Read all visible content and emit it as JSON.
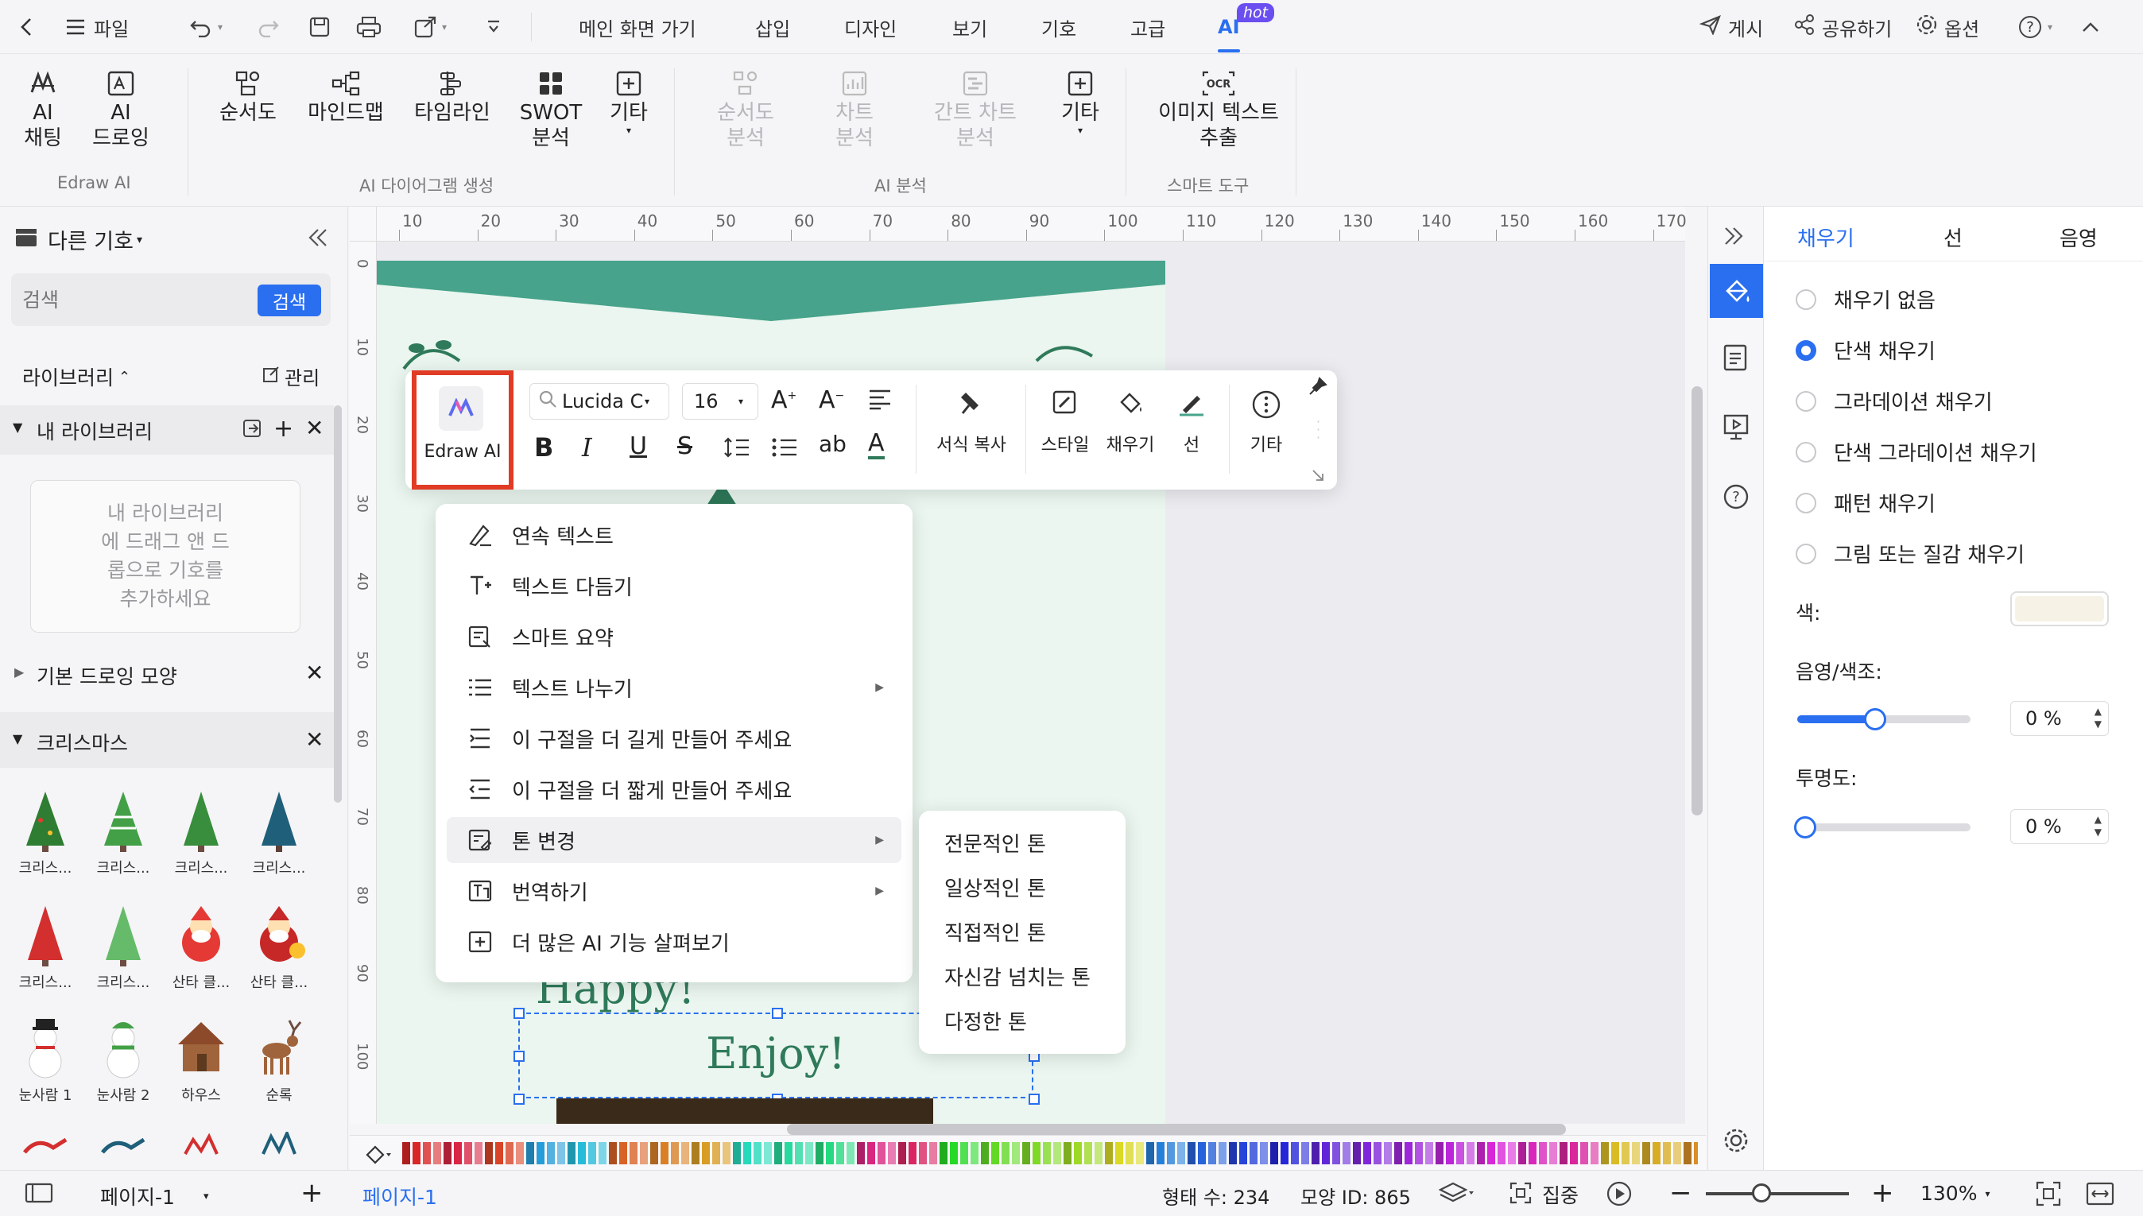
{
  "topbar": {
    "file": "파일",
    "tabs": [
      "메인 화면 가기",
      "삽입",
      "디자인",
      "보기",
      "기호",
      "고급",
      "AI"
    ],
    "ai_badge": "hot",
    "publish": "게시",
    "share": "공유하기",
    "options": "옵션",
    "help": "?"
  },
  "ribbon": {
    "ai_chat": "AI\n채팅",
    "ai_draw": "AI\n드로잉",
    "group1": "Edraw AI",
    "flowchart": "순서도",
    "mindmap": "마인드맵",
    "timeline": "타임라인",
    "swot": "SWOT\n분석",
    "other1": "기타",
    "group2": "AI 다이어그램 생성",
    "flow_analysis": "순서도\n분석",
    "chart_analysis": "차트\n분석",
    "gantt_analysis": "간트 차트\n분석",
    "other2": "기타",
    "group3": "AI 분석",
    "ocr": "이미지 텍스트\n추출",
    "group4": "스마트 도구"
  },
  "left": {
    "title": "다른 기호",
    "search_placeholder": "검색",
    "search_btn": "검색",
    "library": "라이브러리",
    "manage": "관리",
    "my_library": "내 라이브러리",
    "drop_hint": "내 라이브러리\n에 드래그 앤 드\n롭으로 기호를\n추가하세요",
    "basic_shapes": "기본 드로잉 모양",
    "christmas": "크리스마스",
    "symbols": [
      "크리스...",
      "크리스...",
      "크리스...",
      "크리스...",
      "크리스...",
      "크리스...",
      "산타 클...",
      "산타 클...",
      "눈사람 1",
      "눈사람 2",
      "하우스",
      "순록"
    ]
  },
  "ruler": {
    "top": [
      "10",
      "20",
      "30",
      "40",
      "50",
      "60",
      "70",
      "80",
      "90",
      "100",
      "110",
      "120",
      "130",
      "140",
      "150",
      "160",
      "170"
    ],
    "left": [
      "0",
      "10",
      "20",
      "30",
      "40",
      "50",
      "60",
      "70",
      "80",
      "90",
      "100"
    ]
  },
  "toolbar": {
    "edraw_ai": "Edraw AI",
    "font": "Lucida C",
    "size": "16",
    "ab": "ab",
    "format_copy": "서식 복사",
    "style": "스타일",
    "fill": "채우기",
    "line": "선",
    "more": "기타"
  },
  "context_menu": {
    "items": [
      "연속 텍스트",
      "텍스트 다듬기",
      "스마트 요약",
      "텍스트 나누기",
      "이 구절을 더 길게 만들어 주세요",
      "이 구절을 더 짧게 만들어 주세요",
      "톤 변경",
      "번역하기",
      "더 많은 AI 기능 살펴보기"
    ],
    "submenu": [
      "전문적인 톤",
      "일상적인 톤",
      "직접적인 톤",
      "자신감 넘치는 톤",
      "다정한 톤"
    ]
  },
  "canvas_text": {
    "happy": "Happy!",
    "enjoy": "Enjoy!"
  },
  "right_panel": {
    "tabs": [
      "채우기",
      "선",
      "음영"
    ],
    "options": [
      "채우기 없음",
      "단색 채우기",
      "그라데이션 채우기",
      "단색 그라데이션 채우기",
      "패턴 채우기",
      "그림 또는 질감 채우기"
    ],
    "selected_index": 1,
    "color_label": "색:",
    "color_value": "#f6f3e6",
    "shade_label": "음영/색조:",
    "shade_value": "0 %",
    "shade_fraction": 0.45,
    "opacity_label": "투명도:",
    "opacity_value": "0 %",
    "opacity_fraction": 0.0
  },
  "status": {
    "page_dd": "페이지-1",
    "page_tab": "페이지-1",
    "shape_count": "형태 수: 234",
    "shape_id": "모양 ID: 865",
    "focus": "집중",
    "zoom": "130%"
  },
  "colors": {
    "accent": "#2a6ff0",
    "teal": "#47a38b",
    "highlight": "#e03b24"
  }
}
